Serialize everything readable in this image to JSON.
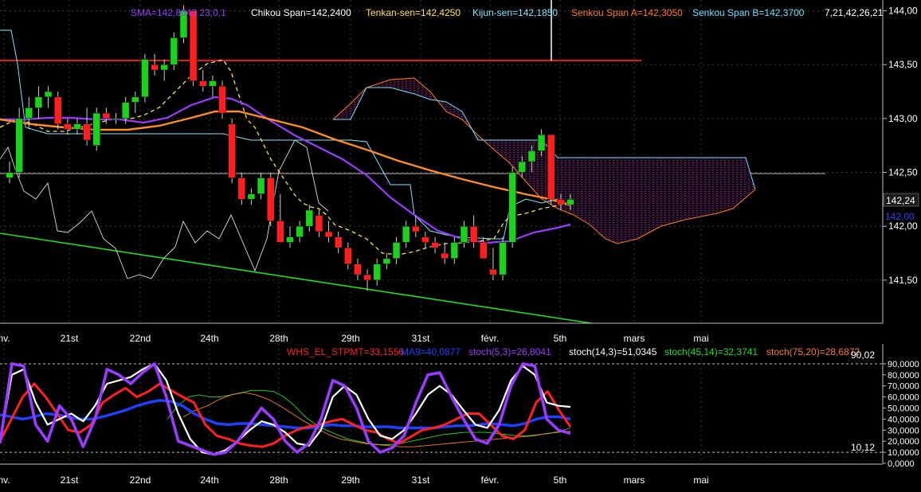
{
  "main_chart": {
    "legend": [
      {
        "text": "SMA=142,8043  23,0,1",
        "color": "#9a3cff"
      },
      {
        "text": "Chikou Span=142,2400",
        "color": "#ffffff"
      },
      {
        "text": "Tenkan-sen=142,4250",
        "color": "#ffe44a"
      },
      {
        "text": "Kijun-sen=142,1850",
        "color": "#7fe7ff"
      },
      {
        "text": "Senkou Span A=142,3050",
        "color": "#ff7a2a"
      },
      {
        "text": "Senkou Span B=142,3700",
        "color": "#6fe0ff"
      },
      {
        "text": "7,21,42,26,21",
        "color": "#ffffff"
      }
    ],
    "y_ticks": [
      "144,00",
      "143,50",
      "143,00",
      "142,50",
      "142,00",
      "141,50"
    ],
    "price_badge": "142,24",
    "price_level_label": "142,00",
    "x_ticks": [
      "nv.",
      "21st",
      "22nd",
      "24th",
      "28th",
      "29th",
      "31st",
      "févr.",
      "5th",
      "mars",
      "mai"
    ],
    "colors": {
      "up": "#1bd11b",
      "down": "#ff1f1f",
      "grid": "#3a3a3a",
      "trendline": "#22dd22",
      "resistance": "#ff2020"
    }
  },
  "oscillator": {
    "legend": [
      {
        "text": "WHS_EL_STPMT=33,1556",
        "color": "#ff2020"
      },
      {
        "text": "MA9=40,0877",
        "color": "#2040ff"
      },
      {
        "text": "stoch(5,3)=26,8041",
        "color": "#9a3cff"
      },
      {
        "text": "stoch(14,3)=51,0345",
        "color": "#ffffff"
      },
      {
        "text": "stoch(45,14)=32,3741",
        "color": "#22dd22"
      },
      {
        "text": "stoch(75,20)=28,6872",
        "color": "#ff7a2a"
      }
    ],
    "y_ticks": [
      "90,0000",
      "80,0000",
      "70,0000",
      "60,0000",
      "50,0000",
      "40,0000",
      "30,0000",
      "20,0000",
      "10,0000",
      "0,0000"
    ],
    "level_labels": [
      "90,02",
      "10,12"
    ],
    "x_ticks": [
      "nv.",
      "21st",
      "22nd",
      "24th",
      "28th",
      "29th",
      "31st",
      "févr.",
      "5th",
      "mars",
      "mai"
    ]
  },
  "chart_data": [
    {
      "type": "candlestick",
      "title": "",
      "ylim": [
        141.1,
        144.1
      ],
      "categories": [
        "nv.",
        "21st",
        "22nd",
        "24th",
        "28th",
        "29th",
        "31st",
        "févr.",
        "5th",
        "mars",
        "mai"
      ],
      "ohlc": [
        [
          142.45,
          142.6,
          142.4,
          142.5
        ],
        [
          142.5,
          143.1,
          142.45,
          143.0
        ],
        [
          143.0,
          143.2,
          142.9,
          143.1
        ],
        [
          143.1,
          143.3,
          143.0,
          143.2
        ],
        [
          143.2,
          143.3,
          143.1,
          143.25
        ],
        [
          143.2,
          143.25,
          142.9,
          142.95
        ],
        [
          142.95,
          143.0,
          142.85,
          142.9
        ],
        [
          142.9,
          143.0,
          142.85,
          142.95
        ],
        [
          142.95,
          143.1,
          142.75,
          142.8
        ],
        [
          142.75,
          143.1,
          142.7,
          143.05
        ],
        [
          143.05,
          143.1,
          142.95,
          143.0
        ],
        [
          143.0,
          143.05,
          142.95,
          143.0
        ],
        [
          143.0,
          143.2,
          142.95,
          143.15
        ],
        [
          143.15,
          143.25,
          143.05,
          143.2
        ],
        [
          143.2,
          143.6,
          143.15,
          143.55
        ],
        [
          143.5,
          143.6,
          143.4,
          143.45
        ],
        [
          143.45,
          143.55,
          143.35,
          143.5
        ],
        [
          143.5,
          143.8,
          143.45,
          143.75
        ],
        [
          143.75,
          144.05,
          143.7,
          144.0
        ],
        [
          144.0,
          144.0,
          143.3,
          143.35
        ],
        [
          143.35,
          143.45,
          143.25,
          143.3
        ],
        [
          143.3,
          143.4,
          143.2,
          143.35
        ],
        [
          143.3,
          143.35,
          143.0,
          143.05
        ],
        [
          142.95,
          143.0,
          142.4,
          142.45
        ],
        [
          142.45,
          142.5,
          142.2,
          142.25
        ],
        [
          142.25,
          142.35,
          142.2,
          142.3
        ],
        [
          142.3,
          142.5,
          142.25,
          142.45
        ],
        [
          142.45,
          142.5,
          142.0,
          142.05
        ],
        [
          142.05,
          142.3,
          141.9,
          141.85
        ],
        [
          141.85,
          142.0,
          141.8,
          141.9
        ],
        [
          141.9,
          142.05,
          141.85,
          142.0
        ],
        [
          142.0,
          142.2,
          141.95,
          142.15
        ],
        [
          142.1,
          142.15,
          141.9,
          141.95
        ],
        [
          141.95,
          142.05,
          141.85,
          141.9
        ],
        [
          141.9,
          141.95,
          141.75,
          141.8
        ],
        [
          141.8,
          141.85,
          141.6,
          141.65
        ],
        [
          141.65,
          141.7,
          141.5,
          141.55
        ],
        [
          141.55,
          141.6,
          141.4,
          141.5
        ],
        [
          141.5,
          141.7,
          141.45,
          141.65
        ],
        [
          141.65,
          141.75,
          141.6,
          141.7
        ],
        [
          141.7,
          141.9,
          141.65,
          141.85
        ],
        [
          141.85,
          142.05,
          141.8,
          142.0
        ],
        [
          142.0,
          142.1,
          141.9,
          141.95
        ],
        [
          141.9,
          141.95,
          141.8,
          141.85
        ],
        [
          141.85,
          141.9,
          141.75,
          141.8
        ],
        [
          141.75,
          141.85,
          141.65,
          141.7
        ],
        [
          141.7,
          141.9,
          141.65,
          141.85
        ],
        [
          141.85,
          142.05,
          141.8,
          142.0
        ],
        [
          142.0,
          142.1,
          141.8,
          141.85
        ],
        [
          141.85,
          141.9,
          141.7,
          141.7
        ],
        [
          141.6,
          141.8,
          141.5,
          141.55
        ],
        [
          141.55,
          141.9,
          141.5,
          141.85
        ],
        [
          141.85,
          142.55,
          141.8,
          142.5
        ],
        [
          142.5,
          142.65,
          142.45,
          142.6
        ],
        [
          142.6,
          142.75,
          142.5,
          142.7
        ],
        [
          142.7,
          142.9,
          142.65,
          142.85
        ],
        [
          142.85,
          142.85,
          142.2,
          142.25
        ],
        [
          142.25,
          142.3,
          142.15,
          142.2
        ],
        [
          142.2,
          142.3,
          142.15,
          142.25
        ]
      ]
    },
    {
      "type": "line",
      "title": "",
      "ylim": [
        0,
        95
      ],
      "series": [
        {
          "name": "WHS_EL_STPMT",
          "color": "#ff2020",
          "values": [
            20,
            40,
            60,
            72,
            60,
            45,
            30,
            28,
            35,
            55,
            62,
            68,
            60,
            65,
            72,
            66,
            60,
            55,
            35,
            25,
            22,
            18,
            16,
            15,
            18,
            25,
            30,
            33,
            35,
            38,
            40,
            35,
            30,
            28,
            22,
            18,
            24,
            30,
            32,
            35,
            40,
            45,
            45,
            35,
            25,
            22,
            30,
            55,
            65,
            48,
            33
          ]
        },
        {
          "name": "MA9",
          "color": "#2040ff",
          "values": [
            44,
            42,
            40,
            42,
            45,
            44,
            42,
            40,
            40,
            42,
            45,
            48,
            52,
            55,
            57,
            56,
            52,
            45,
            40,
            36,
            35,
            36,
            36,
            35,
            34,
            33,
            32,
            32,
            33,
            35,
            34,
            34,
            33,
            33,
            33,
            32,
            32,
            32,
            32,
            33,
            34,
            34,
            35,
            36,
            35,
            34,
            36,
            40,
            42,
            42,
            40
          ]
        },
        {
          "name": "stoch(5,3)",
          "color": "#9a3cff",
          "values": [
            18,
            90,
            88,
            35,
            20,
            52,
            40,
            15,
            40,
            85,
            80,
            72,
            82,
            90,
            60,
            20,
            16,
            12,
            8,
            10,
            20,
            35,
            50,
            40,
            20,
            10,
            18,
            40,
            75,
            70,
            50,
            20,
            10,
            14,
            25,
            55,
            80,
            82,
            60,
            40,
            22,
            18,
            35,
            70,
            90,
            88,
            40,
            30,
            27
          ]
        },
        {
          "name": "stoch(14,3)",
          "color": "#ffffff",
          "values": [
            20,
            80,
            85,
            55,
            35,
            40,
            45,
            38,
            52,
            72,
            75,
            78,
            85,
            90,
            75,
            45,
            22,
            10,
            8,
            12,
            20,
            30,
            38,
            35,
            28,
            18,
            16,
            30,
            60,
            70,
            62,
            40,
            25,
            22,
            30,
            45,
            62,
            70,
            62,
            48,
            35,
            32,
            48,
            75,
            88,
            80,
            55,
            52,
            51
          ]
        },
        {
          "name": "stoch(45,14)",
          "color": "#22dd22",
          "values": [
            40,
            52,
            60,
            62,
            60,
            60,
            62,
            64,
            66,
            66,
            65,
            60,
            52,
            42,
            35,
            30,
            26,
            22,
            20,
            18,
            17,
            17,
            18,
            20,
            22,
            24,
            26,
            27,
            28,
            28,
            28,
            27,
            26,
            25,
            25,
            26,
            27,
            29,
            32
          ]
        },
        {
          "name": "stoch(75,20)",
          "color": "#ff7a2a",
          "values": [
            42,
            48,
            52,
            58,
            62,
            64,
            62,
            58,
            52,
            45,
            38,
            32,
            26,
            22,
            20,
            18,
            17,
            16,
            15,
            15,
            16,
            17,
            18,
            19,
            20,
            21,
            22,
            23,
            24,
            25,
            27,
            28,
            29
          ]
        }
      ]
    }
  ]
}
